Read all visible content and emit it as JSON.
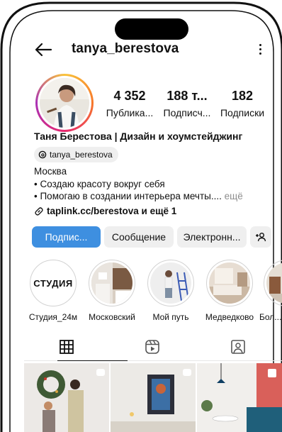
{
  "profile": {
    "username": "tanya_berestova",
    "full_name": "Таня Берестова | Дизайн и хоумстейджинг",
    "threads_handle": "tanya_berestova"
  },
  "stats": [
    {
      "value": "4 352",
      "label": "Публика..."
    },
    {
      "value": "188 т...",
      "label": "Подписч..."
    },
    {
      "value": "182",
      "label": "Подписки"
    }
  ],
  "bio": {
    "lines": [
      "Москва",
      "• Создаю красоту вокруг себя",
      "• Помогаю в создании интерьера мечты...."
    ],
    "more_label": " ещё",
    "link_text": "taplink.cc/berestova и ещё 1"
  },
  "buttons": {
    "follow": "Подпис...",
    "message": "Сообщение",
    "email": "Электронн...",
    "add_person_icon": "add-person-icon"
  },
  "highlights": [
    {
      "label": "Студия_24м",
      "cover_text": "СТУДИЯ"
    },
    {
      "label": "Московский"
    },
    {
      "label": "Мой путь"
    },
    {
      "label": "Медведково"
    },
    {
      "label": "Бол..."
    }
  ],
  "tabs": [
    "grid-icon",
    "reels-icon",
    "tagged-icon"
  ],
  "colors": {
    "accent": "#3e8fe0",
    "secondary_button": "#efefef",
    "muted_text": "#8e8e8e"
  }
}
